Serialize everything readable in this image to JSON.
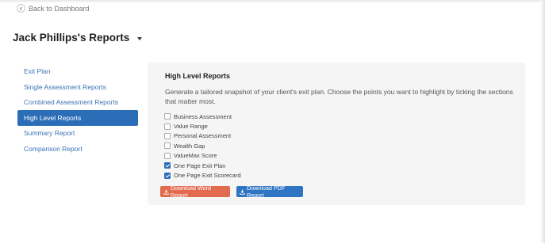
{
  "header": {
    "back_label": "Back to Dashboard",
    "page_title": "Jack Phillips's Reports"
  },
  "sidebar": {
    "items": [
      {
        "label": "Exit Plan",
        "active": false
      },
      {
        "label": "Single Assessment Reports",
        "active": false
      },
      {
        "label": "Combined Assessment Reports",
        "active": false
      },
      {
        "label": "High Level Reports",
        "active": true
      },
      {
        "label": "Summary Report",
        "active": false
      },
      {
        "label": "Comparison Report",
        "active": false
      }
    ]
  },
  "panel": {
    "title": "High Level Reports",
    "description": "Generate a tailored snapshot of your client's exit plan. Choose the points you want to highlight by ticking the sections that matter most.",
    "checkboxes": [
      {
        "label": "Business Assessment",
        "checked": false
      },
      {
        "label": "Value Range",
        "checked": false
      },
      {
        "label": "Personal Assessment",
        "checked": false
      },
      {
        "label": "Wealth Gap",
        "checked": false
      },
      {
        "label": "ValueMax Score",
        "checked": false
      },
      {
        "label": "One Page Exit Plan",
        "checked": true
      },
      {
        "label": "One Page Exit Scorecard",
        "checked": true
      }
    ],
    "download_word_label": "Download Word Report",
    "download_pdf_label": "Download PDF Report"
  },
  "colors": {
    "accent": "#2c6db8",
    "link": "#3a73b6",
    "word_button": "#e26a4f",
    "pdf_button": "#2f75c3",
    "panel_bg": "#f5f5f5"
  },
  "icons": {
    "back": "chevron-left-icon",
    "title_dropdown": "caret-down-icon",
    "download": "download-icon"
  }
}
